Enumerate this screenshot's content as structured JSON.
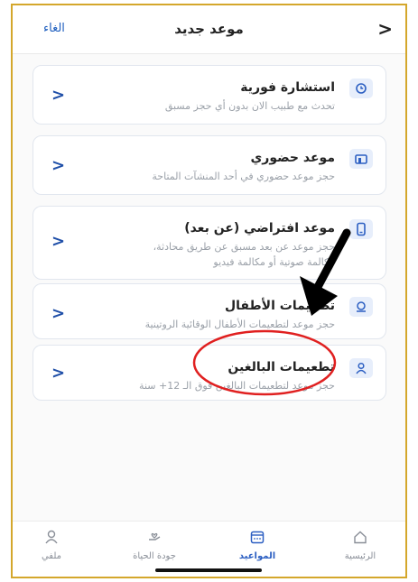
{
  "header": {
    "back_icon": "chevron-right-icon",
    "title": "موعد جديد",
    "cancel_label": "الغاء"
  },
  "options": [
    {
      "title": "استشارة فورية",
      "subtitle": "تحدث مع طبيب الان بدون أي حجز مسبق",
      "icon": "clock-chat-icon"
    },
    {
      "title": "موعد حضوري",
      "subtitle": "حجز موعد حضوري في أحد المنشآت المتاحة",
      "icon": "building-icon"
    },
    {
      "title": "موعد افتراضي (عن بعد)",
      "subtitle_line1": "حجز موعد عن بعد مسبق عن طريق محادثة،",
      "subtitle_line2": "مكالمة صوتية أو مكالمة فيديو",
      "icon": "phone-icon"
    },
    {
      "title": "تطعيمات الأطفال",
      "subtitle": "حجز موعد لتطعيمات الأطفال الوقائية الروتينية",
      "icon": "child-icon"
    },
    {
      "title": "تطعيمات البالغين",
      "subtitle": "حجز موعد لتطعيمات البالغين فوق الـ 12+ سنة",
      "icon": "adult-person-icon"
    }
  ],
  "bottom_nav": {
    "home": "الرئيسية",
    "appointments": "المواعيد",
    "quality_of_life": "جودة الحياة",
    "profile": "ملفي",
    "active": "المواعيد"
  },
  "colors": {
    "accent": "#2c5fc2",
    "annotation_circle": "#e02020",
    "annotation_arrow": "#000000",
    "frame_border": "#d4a72c"
  }
}
